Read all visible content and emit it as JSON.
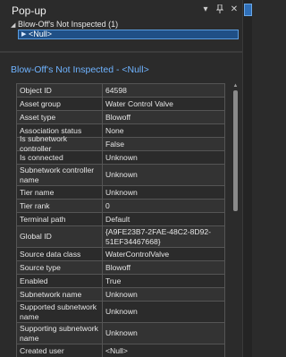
{
  "panel": {
    "title": "Pop-up",
    "icons": [
      "chevron-down-icon",
      "pin-icon",
      "close-icon"
    ]
  },
  "tree": {
    "parent_label": "Blow-Off's Not Inspected (1)",
    "child_label": "<Null>"
  },
  "content": {
    "title": "Blow-Off's Not Inspected - <Null>"
  },
  "attributes": [
    {
      "key": "Object ID",
      "value": "64598"
    },
    {
      "key": "Asset group",
      "value": "Water Control Valve"
    },
    {
      "key": "Asset type",
      "value": "Blowoff"
    },
    {
      "key": "Association status",
      "value": "None"
    },
    {
      "key": "Is subnetwork controller",
      "value": "False"
    },
    {
      "key": "Is connected",
      "value": "Unknown"
    },
    {
      "key": "Subnetwork controller name",
      "value": "Unknown"
    },
    {
      "key": "Tier name",
      "value": "Unknown"
    },
    {
      "key": "Tier rank",
      "value": "0"
    },
    {
      "key": "Terminal path",
      "value": "Default"
    },
    {
      "key": "Global ID",
      "value": "{A9FE23B7-2FAE-48C2-8D92-51EF34467668}"
    },
    {
      "key": "Source data class",
      "value": "WaterControlValve"
    },
    {
      "key": "Source type",
      "value": "Blowoff"
    },
    {
      "key": "Enabled",
      "value": "True"
    },
    {
      "key": "Subnetwork name",
      "value": "Unknown"
    },
    {
      "key": "Supported subnetwork name",
      "value": "Unknown"
    },
    {
      "key": "Supporting subnetwork name",
      "value": "Unknown"
    },
    {
      "key": "Created user",
      "value": "<Null>"
    }
  ]
}
